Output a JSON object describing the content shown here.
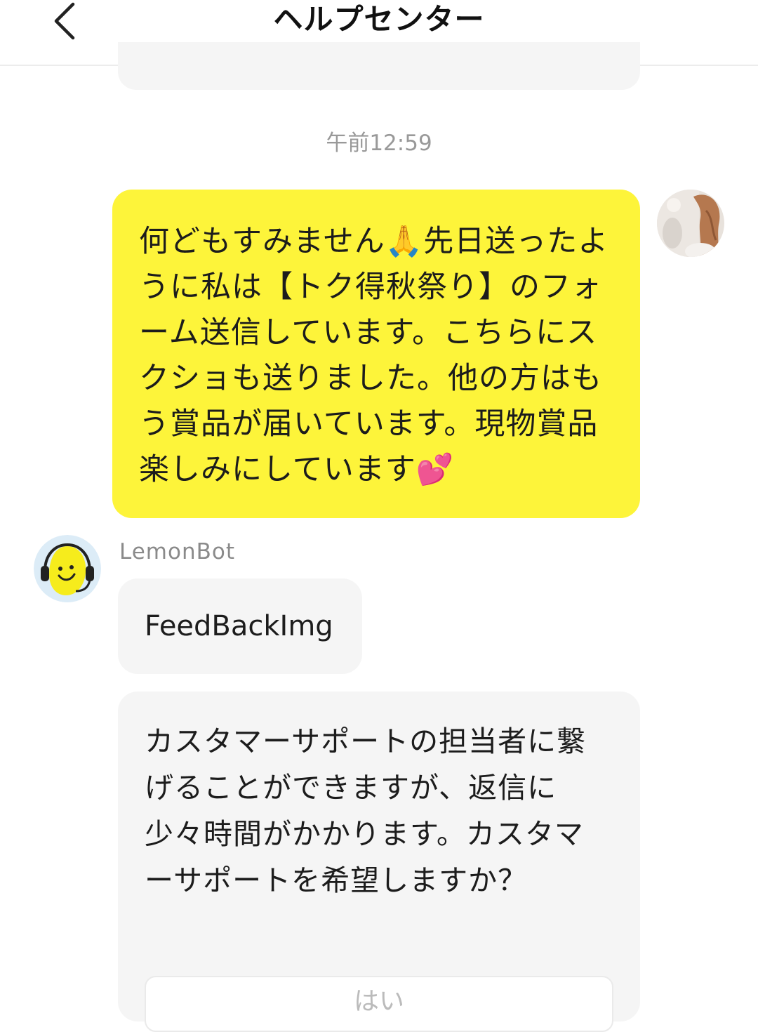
{
  "header": {
    "title": "ヘルプセンター",
    "back_icon": "chevron-left-icon"
  },
  "chat": {
    "timestamp": "午前12:59",
    "user_message": "何どもすみません🙏先日送ったように私は【トク得秋祭り】のフォーム送信しています。こちらにスクショも送りました。他の方はもう賞品が届いています。現物賞品楽しみにしています💕",
    "bot_name": "LemonBot",
    "bot_message_1": "FeedBackImg",
    "bot_message_2": "カスタマーサポートの担当者に繋げることができますが、返信に少々時間がかかります。カスタマーサポートを希望しますか？",
    "yes_button_label": "はい"
  },
  "colors": {
    "user_bubble": "#fdf43a",
    "bot_bubble": "#f5f5f5",
    "timestamp": "#999999",
    "bot_name": "#8a8a8a"
  }
}
